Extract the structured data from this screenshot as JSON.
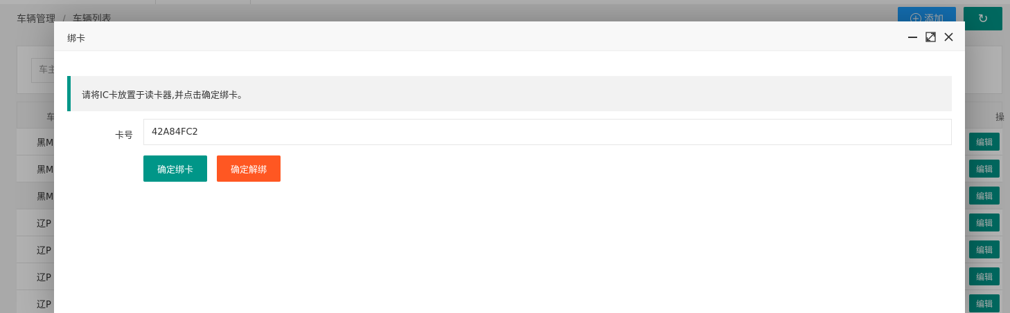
{
  "background": {
    "breadcrumb": [
      "车辆管理",
      "车辆列表"
    ],
    "breadcrumb_sep": "/",
    "add_button": "添加",
    "search_placeholder": "车主",
    "table_header_first": "车",
    "table_header_last": "操",
    "rows": [
      {
        "plate": "黑M",
        "edit": "编辑"
      },
      {
        "plate": "黑M",
        "edit": "编辑"
      },
      {
        "plate": "黑M",
        "edit": "编辑"
      },
      {
        "plate": "辽P",
        "edit": "编辑"
      },
      {
        "plate": "辽P",
        "edit": "编辑"
      },
      {
        "plate": "辽P",
        "edit": "编辑"
      },
      {
        "plate": "辽P",
        "edit": "编辑"
      }
    ]
  },
  "modal": {
    "title": "绑卡",
    "tip": "请将IC卡放置于读卡器,并点击确定绑卡。",
    "card_label": "卡号",
    "card_value": "42A84FC2",
    "confirm_bind": "确定绑卡",
    "confirm_unbind": "确定解绑"
  },
  "colors": {
    "primary": "#009688",
    "warm": "#FF5722",
    "blue": "#1E9FFF"
  }
}
